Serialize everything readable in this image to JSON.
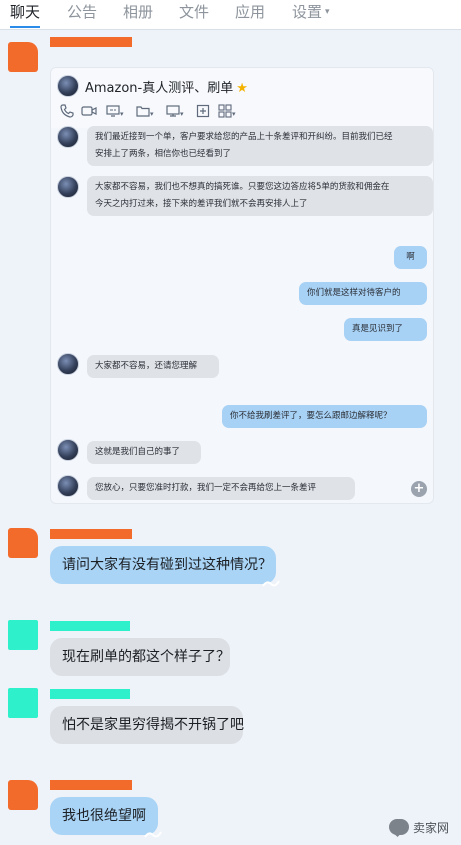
{
  "tabs": [
    {
      "label": "聊天",
      "active": true
    },
    {
      "label": "公告"
    },
    {
      "label": "相册"
    },
    {
      "label": "文件"
    },
    {
      "label": "应用"
    },
    {
      "label": "设置",
      "has_dropdown": true
    }
  ],
  "caret": "▾",
  "embedded": {
    "title": "Amazon-真人测评、刷单",
    "star": "★",
    "toolbar_icons": [
      "phone-icon",
      "video-icon",
      "screen-share-icon",
      "folder-icon",
      "screen-icon",
      "add-icon",
      "apps-icon"
    ],
    "messages": [
      {
        "side": "left",
        "lines": [
          "我们最近接到一个单，客户要求给您的产品上十条差评和开纠纷。目前我们已经",
          "安排上了两条，相信你也已经看到了"
        ]
      },
      {
        "side": "left",
        "lines": [
          "大家都不容易，我们也不想真的搞死谁。只要您这边答应将5单的货款和佣金在",
          "今天之内打过来，接下来的差评我们就不会再安排人上了"
        ]
      },
      {
        "side": "right",
        "lines": [
          "啊"
        ]
      },
      {
        "side": "right",
        "lines": [
          "你们就是这样对待客户的"
        ]
      },
      {
        "side": "right",
        "lines": [
          "真是见识到了"
        ]
      },
      {
        "side": "left",
        "lines": [
          "大家都不容易，还请您理解"
        ]
      },
      {
        "side": "right",
        "lines": [
          "你不给我刷差评了，要怎么跟邮边解释呢？"
        ]
      },
      {
        "side": "left",
        "lines": [
          "这就是我们自己的事了"
        ]
      },
      {
        "side": "left",
        "lines": [
          "您放心，只要您准时打款，我们一定不会再给您上一条差评"
        ]
      }
    ],
    "zoom_icon": "+"
  },
  "chat": [
    {
      "sender_color": "#f26b2b",
      "text": "请问大家有没有碰到过这种情况？",
      "bubble": "blue"
    },
    {
      "sender_color": "#2ef1cc",
      "text": "现在刷单的都这个样子了？",
      "bubble": "grey"
    },
    {
      "sender_color": "#2ef1cc",
      "text": "怕不是家里穷得揭不开锅了吧",
      "bubble": "grey"
    },
    {
      "sender_color": "#f26b2b",
      "text": "我也很绝望啊",
      "bubble": "blue"
    }
  ],
  "watermark": {
    "text": "卖家网"
  },
  "colors": {
    "accent": "#2a8be8",
    "bubble_blue": "#a9d4f6",
    "bubble_grey": "#dcdfe3",
    "orange": "#f26b2b",
    "mint": "#2ef1cc"
  }
}
